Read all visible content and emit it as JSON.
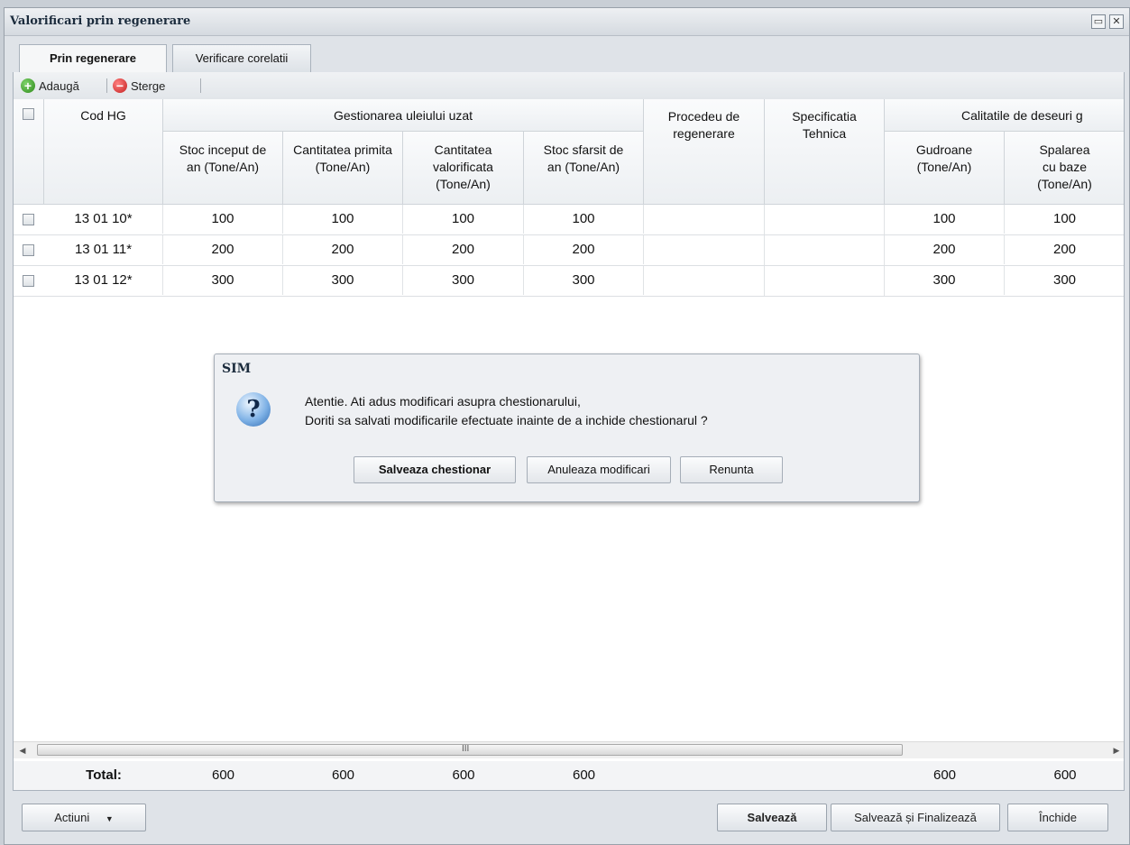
{
  "window": {
    "title": "Valorificari prin regenerare"
  },
  "tabs": [
    {
      "label": "Prin regenerare",
      "active": true
    },
    {
      "label": "Verificare corelatii",
      "active": false
    }
  ],
  "toolbar": {
    "add_label": "Adaugă",
    "delete_label": "Sterge"
  },
  "grid": {
    "headers": {
      "cod_hg": "Cod HG",
      "group_gestionare": "Gestionarea uleiului uzat",
      "stoc_inceput": "Stoc inceput de an (Tone/An)",
      "cantitatea_primita": "Cantitatea primita (Tone/An)",
      "cantitatea_valorificata": "Cantitatea valorificata (Tone/An)",
      "stoc_sfarsit": "Stoc sfarsit de an (Tone/An)",
      "procedeu": "Procedeu de regenerare",
      "specificatia": "Specificatia Tehnica",
      "group_calitatile": "Calitatile de deseuri g",
      "gudroane": "Gudroane (Tone/An)",
      "spalarea": "Spalarea cu baze (Tone/An)"
    },
    "rows": [
      {
        "cod": "13 01 10*",
        "stoc_inceput": "100",
        "primita": "100",
        "valorificata": "100",
        "stoc_sfarsit": "100",
        "procedeu": "",
        "specificatia": "",
        "gudroane": "100",
        "spalarea": "100"
      },
      {
        "cod": "13 01 11*",
        "stoc_inceput": "200",
        "primita": "200",
        "valorificata": "200",
        "stoc_sfarsit": "200",
        "procedeu": "",
        "specificatia": "",
        "gudroane": "200",
        "spalarea": "200"
      },
      {
        "cod": "13 01 12*",
        "stoc_inceput": "300",
        "primita": "300",
        "valorificata": "300",
        "stoc_sfarsit": "300",
        "procedeu": "",
        "specificatia": "",
        "gudroane": "300",
        "spalarea": "300"
      }
    ],
    "totals": {
      "label": "Total:",
      "stoc_inceput": "600",
      "primita": "600",
      "valorificata": "600",
      "stoc_sfarsit": "600",
      "gudroane": "600",
      "spalarea": "600"
    },
    "scroll_thumb_glyph": "III"
  },
  "dialog": {
    "title": "SIM",
    "icon": "question-icon",
    "line1": "Atentie. Ati adus modificari asupra chestionarului,",
    "line2": "Doriti sa salvati modificarile efectuate inainte de a inchide chestionarul ?",
    "buttons": {
      "save": "Salveaza chestionar",
      "discard": "Anuleaza modificari",
      "cancel": "Renunta"
    }
  },
  "bottom": {
    "actions_label": "Actiuni",
    "save_label": "Salvează",
    "save_finalize_label": "Salvează și Finalizează",
    "close_label": "Închide"
  }
}
